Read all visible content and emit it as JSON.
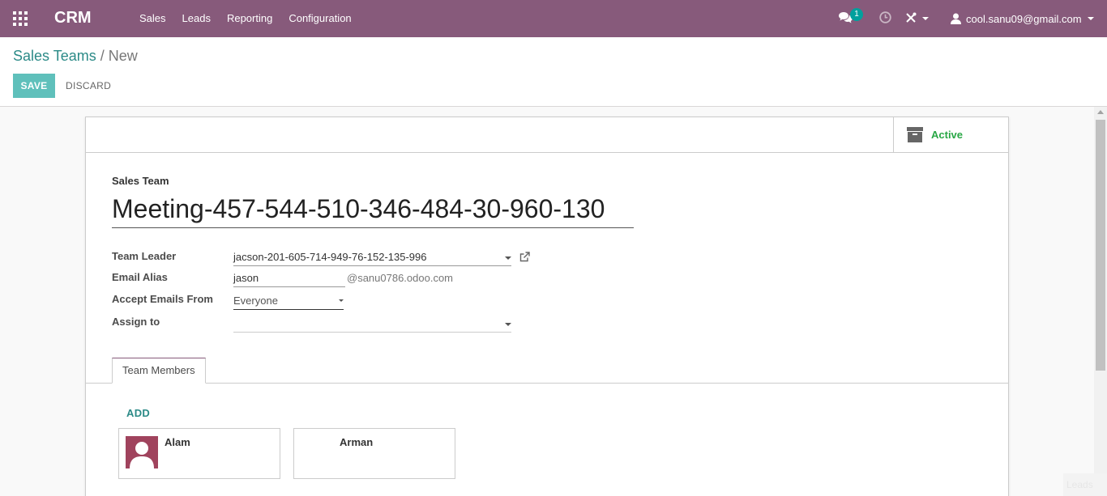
{
  "navbar": {
    "brand": "CRM",
    "menu": [
      "Sales",
      "Leads",
      "Reporting",
      "Configuration"
    ],
    "chat_badge": "1",
    "user_email": "cool.sanu09@gmail.com",
    "bg_color": "#875a7b"
  },
  "control_panel": {
    "breadcrumb_parent": "Sales Teams",
    "breadcrumb_sep": "/",
    "breadcrumb_current": "New",
    "save_label": "SAVE",
    "discard_label": "DISCARD"
  },
  "form": {
    "active_label": "Active",
    "title_label": "Sales Team",
    "title_value": "Meeting-457-544-510-346-484-30-960-130",
    "fields": {
      "team_leader_label": "Team Leader",
      "team_leader_value": "jacson-201-605-714-949-76-152-135-996",
      "email_alias_label": "Email Alias",
      "email_alias_value": "jason",
      "email_alias_domain": "@sanu0786.odoo.com",
      "accept_emails_label": "Accept Emails From",
      "accept_emails_value": "Everyone",
      "assign_to_label": "Assign to",
      "assign_to_value": ""
    },
    "tab_label": "Team Members",
    "add_label": "ADD",
    "members": [
      "Alam",
      "Arman"
    ]
  },
  "footer_faded_text": "Leads"
}
